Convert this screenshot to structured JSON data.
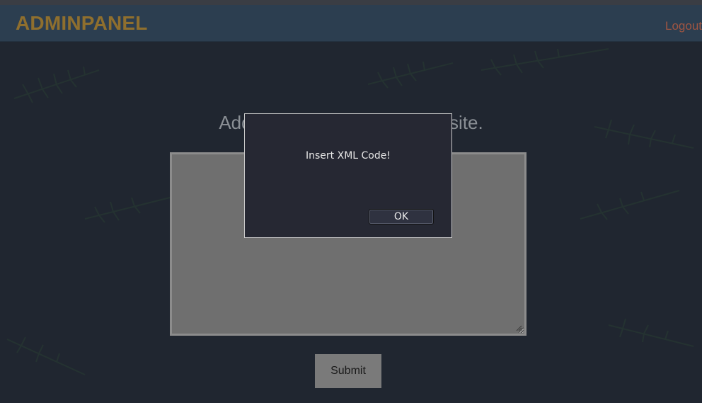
{
  "navbar": {
    "brand": "ADMINPANEL",
    "logout_label": "Logout"
  },
  "main": {
    "heading": "Add XML content to the website.",
    "textarea_value": "",
    "submit_label": "Submit"
  },
  "dialog": {
    "message": "Insert XML Code!",
    "ok_label": "OK"
  },
  "colors": {
    "navbar_bg": "#2c3e50",
    "brand": "#8f6f2e",
    "logout": "#a05542",
    "page_bg": "#202630",
    "textarea_bg": "#6f6f6f",
    "dialog_bg": "#262833"
  }
}
